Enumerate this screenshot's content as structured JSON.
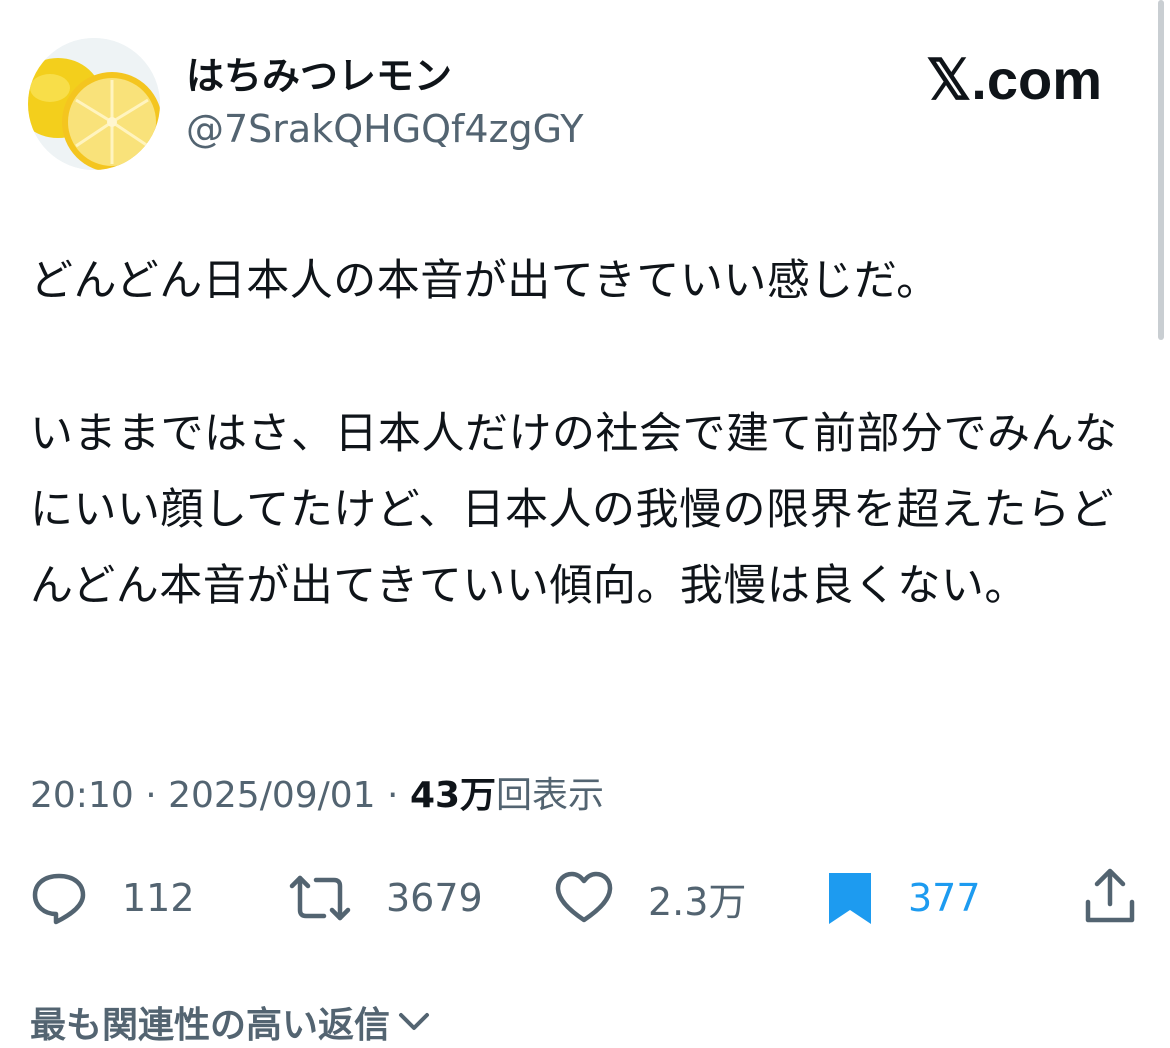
{
  "author": {
    "display_name": "はちみつレモン",
    "handle": "@7SrakQHGQf4zgGY"
  },
  "site_logo": "𝕏.com",
  "tweet": {
    "paragraph_1": "どんどん日本人の本音が出てきていい感じだ。",
    "paragraph_2": "いままではさ、日本人だけの社会で建て前部分でみんなにいい顔してたけど、日本人の我慢の限界を超えたらどんどん本音が出てきていい傾向。我慢は良くない。"
  },
  "meta": {
    "time": "20:10",
    "separator": " · ",
    "date": "2025/09/01",
    "views_count": "43万",
    "views_label": "回表示"
  },
  "actions": {
    "replies": "112",
    "reposts": "3679",
    "likes": "2.3万",
    "bookmarks": "377"
  },
  "replies_sort_label": "最も関連性の高い返信",
  "icons": [
    "reply-icon",
    "repost-icon",
    "like-icon",
    "bookmark-icon",
    "share-icon",
    "chevron-down-icon"
  ],
  "colors": {
    "text": "#0f1419",
    "secondary": "#536471",
    "accent": "#1d9bf0",
    "lemon": "#f6d431"
  }
}
